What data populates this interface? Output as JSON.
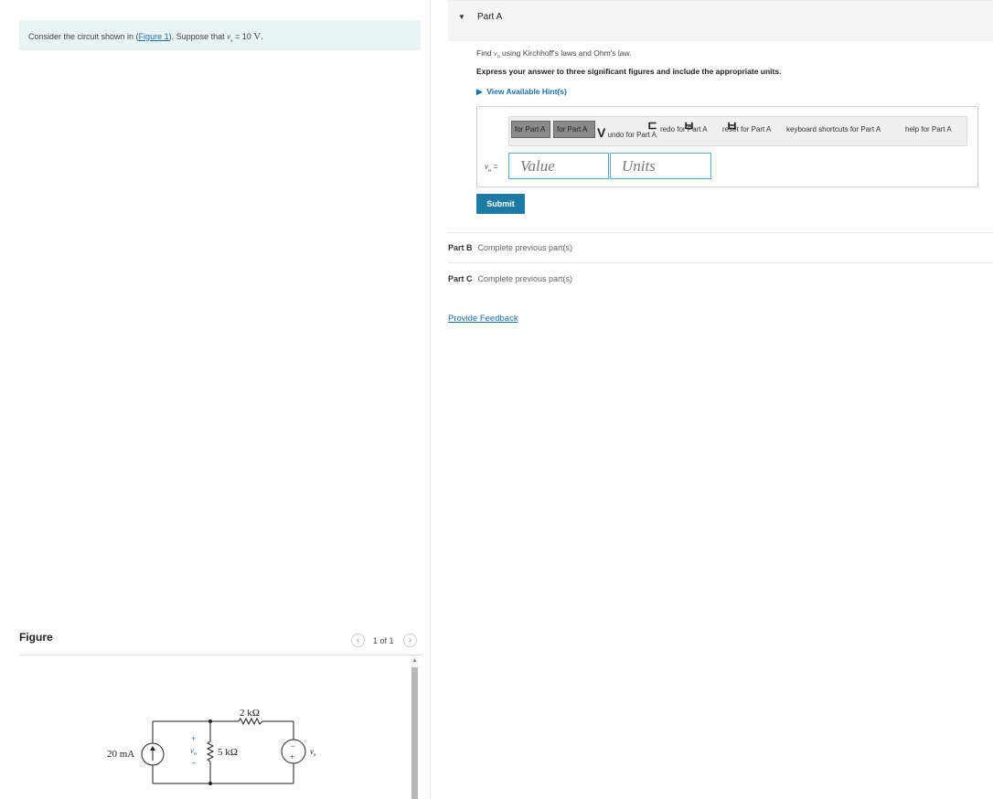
{
  "problem": {
    "prefix": "Consider the circuit shown in (",
    "figure_link": "Figure 1",
    "middle": "). Suppose that ",
    "var": "v",
    "var_sub": "s",
    "equals": " = 10 ",
    "unit": "V",
    "suffix": "."
  },
  "figure": {
    "title": "Figure",
    "pager": "1 of 1",
    "prev_icon": "‹",
    "next_icon": "›",
    "circuit": {
      "current_source": "20 mA",
      "resistor_top": "2 kΩ",
      "resistor_mid": "5 kΩ",
      "vo_var": "v",
      "vo_sub": "o",
      "plus": "+",
      "minus": "−",
      "vs_var": "v",
      "vs_sub": "s"
    }
  },
  "part_a": {
    "label": "Part A",
    "find_prefix": "Find ",
    "find_var": "v",
    "find_sub": "o",
    "find_suffix": " using Kirchhoff's laws and Ohm's law.",
    "express": "Express your answer to three significant figures and include the appropriate units.",
    "hint": "View Available Hint(s)",
    "toolbar": {
      "btn1": "for Part A",
      "btn2": "for Part A",
      "undo": "undo for Part A",
      "redo": "redo for Part A",
      "reset": "reset for Part A",
      "keyboard": "keyboard shortcuts for Part A",
      "help": "help for Part A"
    },
    "answer_var": "v",
    "answer_sub": "o",
    "answer_eq": " =",
    "value_placeholder": "Value",
    "units_placeholder": "Units",
    "submit": "Submit"
  },
  "part_b": {
    "label": "Part B",
    "status": "Complete previous part(s)"
  },
  "part_c": {
    "label": "Part C",
    "status": "Complete previous part(s)"
  },
  "feedback": "Provide Feedback",
  "colors": {
    "link": "#1a6fb0",
    "submit": "#1c7aa5",
    "problem_bg": "#e9f4f4"
  }
}
